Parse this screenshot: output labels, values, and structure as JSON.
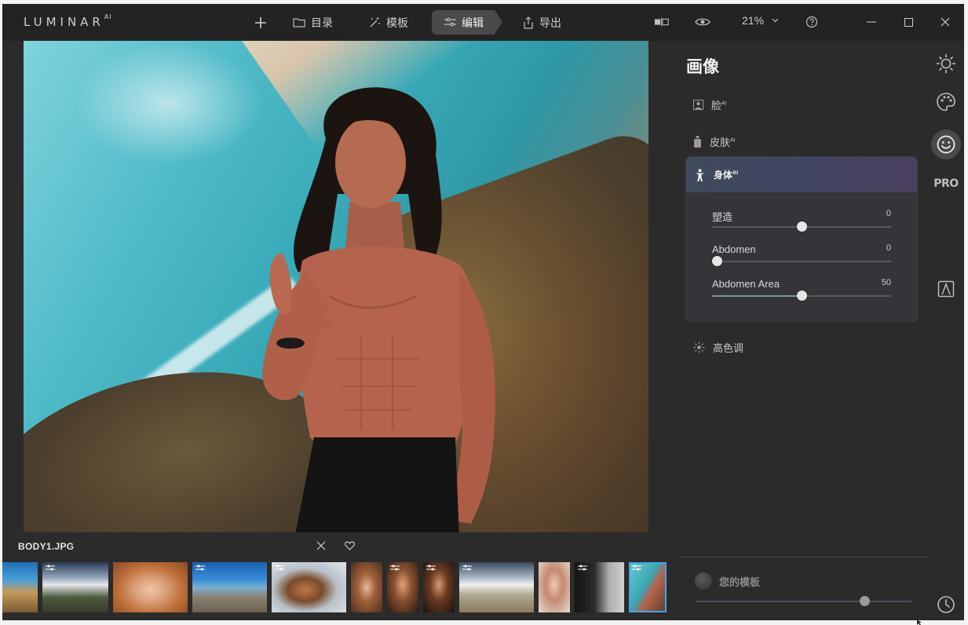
{
  "app": {
    "logo": "LUMINAR",
    "logo_sup": "AI"
  },
  "topbar": {
    "catalog_label": "目录",
    "templates_label": "模板",
    "edit_label": "编辑",
    "export_label": "导出",
    "zoom_value": "21%"
  },
  "photo": {
    "filename": "BODY1.JPG",
    "watermark": ""
  },
  "panel": {
    "title": "画像",
    "tools": [
      {
        "label": "脸",
        "sup": "AI"
      },
      {
        "label": "皮肤",
        "sup": "AI"
      },
      {
        "label": "身体",
        "sup": "AI"
      },
      {
        "label": "高色调",
        "sup": ""
      }
    ],
    "sliders": [
      {
        "label": "塑造",
        "value": "0",
        "position": 0.5
      },
      {
        "label": "Abdomen",
        "value": "0",
        "position": 0.0
      },
      {
        "label": "Abdomen Area",
        "value": "50",
        "position": 0.5
      }
    ],
    "templates_label": "您的模板",
    "templates_slider": 0.78
  },
  "rail": {
    "pro_label": "PRO"
  },
  "colors": {
    "accent": "#3fa7e4",
    "panel": "#2b2b2b",
    "topbar": "#232323",
    "card_head": "#414563"
  },
  "filmstrip": {
    "selected_index": 11,
    "count": 12
  }
}
